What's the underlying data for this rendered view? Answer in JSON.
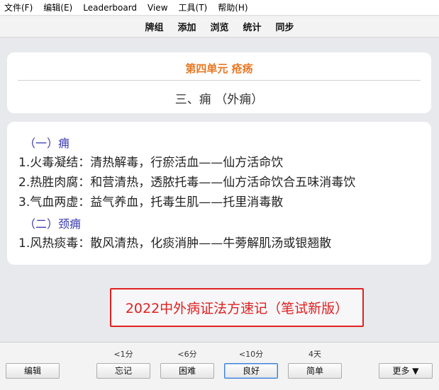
{
  "menu": {
    "items": [
      "文件(F)",
      "编辑(E)",
      "Leaderboard",
      "View",
      "工具(T)",
      "帮助(H)"
    ]
  },
  "toolbar": {
    "items": [
      "牌组",
      "添加",
      "浏览",
      "统计",
      "同步"
    ]
  },
  "card": {
    "title": "第四单元 疮疡",
    "subtitle": "三、痈 （外痈）",
    "sections": [
      {
        "heading": "（一）痈",
        "lines": [
          "1.火毒凝结：清热解毒，行瘀活血——仙方活命饮",
          "2.热胜肉腐：和营清热，透脓托毒——仙方活命饮合五味消毒饮",
          "3.气血两虚：益气养血，托毒生肌——托里消毒散"
        ]
      },
      {
        "heading": "（二）颈痈",
        "lines": [
          "1.风热痰毒：散风清热，化痰消肿——牛蒡解肌汤或银翘散"
        ]
      }
    ]
  },
  "banner": {
    "text": "2022中外病证法方速记（笔试新版）",
    "color": "#e02020"
  },
  "bottom": {
    "edit_label": "编辑",
    "answers": [
      {
        "interval": "<1分",
        "label": "忘记"
      },
      {
        "interval": "<6分",
        "label": "困难"
      },
      {
        "interval": "<10分",
        "label": "良好"
      },
      {
        "interval": "4天",
        "label": "简单"
      }
    ],
    "more_label": "更多 ▼"
  },
  "colors": {
    "title_accent": "#e87722",
    "section_heading": "#3a3ab0",
    "banner_border": "#e02020"
  }
}
